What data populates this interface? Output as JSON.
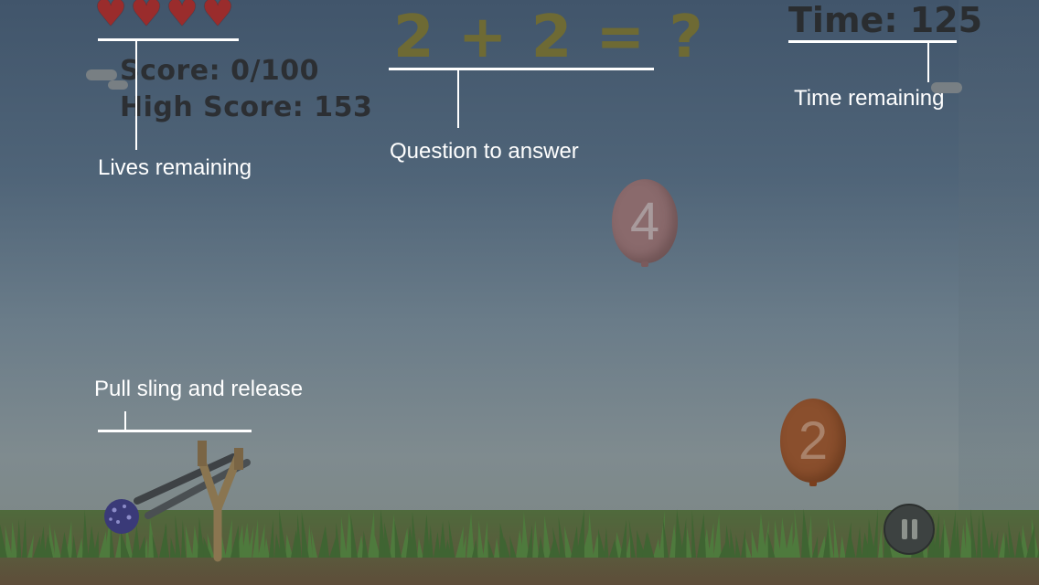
{
  "hud": {
    "lives": 4,
    "score": "Score: 0/100",
    "high_score": "High Score: 153",
    "question": "2 + 2 = ?",
    "time": "Time: 125"
  },
  "balloons": [
    {
      "value": "4",
      "color": "#8a6a6c"
    },
    {
      "value": "2",
      "color": "#8a4f2d"
    }
  ],
  "annotations": {
    "lives": "Lives remaining",
    "question": "Question to answer",
    "time": "Time remaining",
    "sling": "Pull sling and release"
  },
  "icons": {
    "heart": "heart-icon",
    "pause": "pause-icon",
    "projectile": "ball-icon",
    "slingshot": "slingshot-icon"
  },
  "colors": {
    "question": "#6e6a34",
    "heart": "#9a2c2c",
    "annotation": "#ffffff"
  }
}
